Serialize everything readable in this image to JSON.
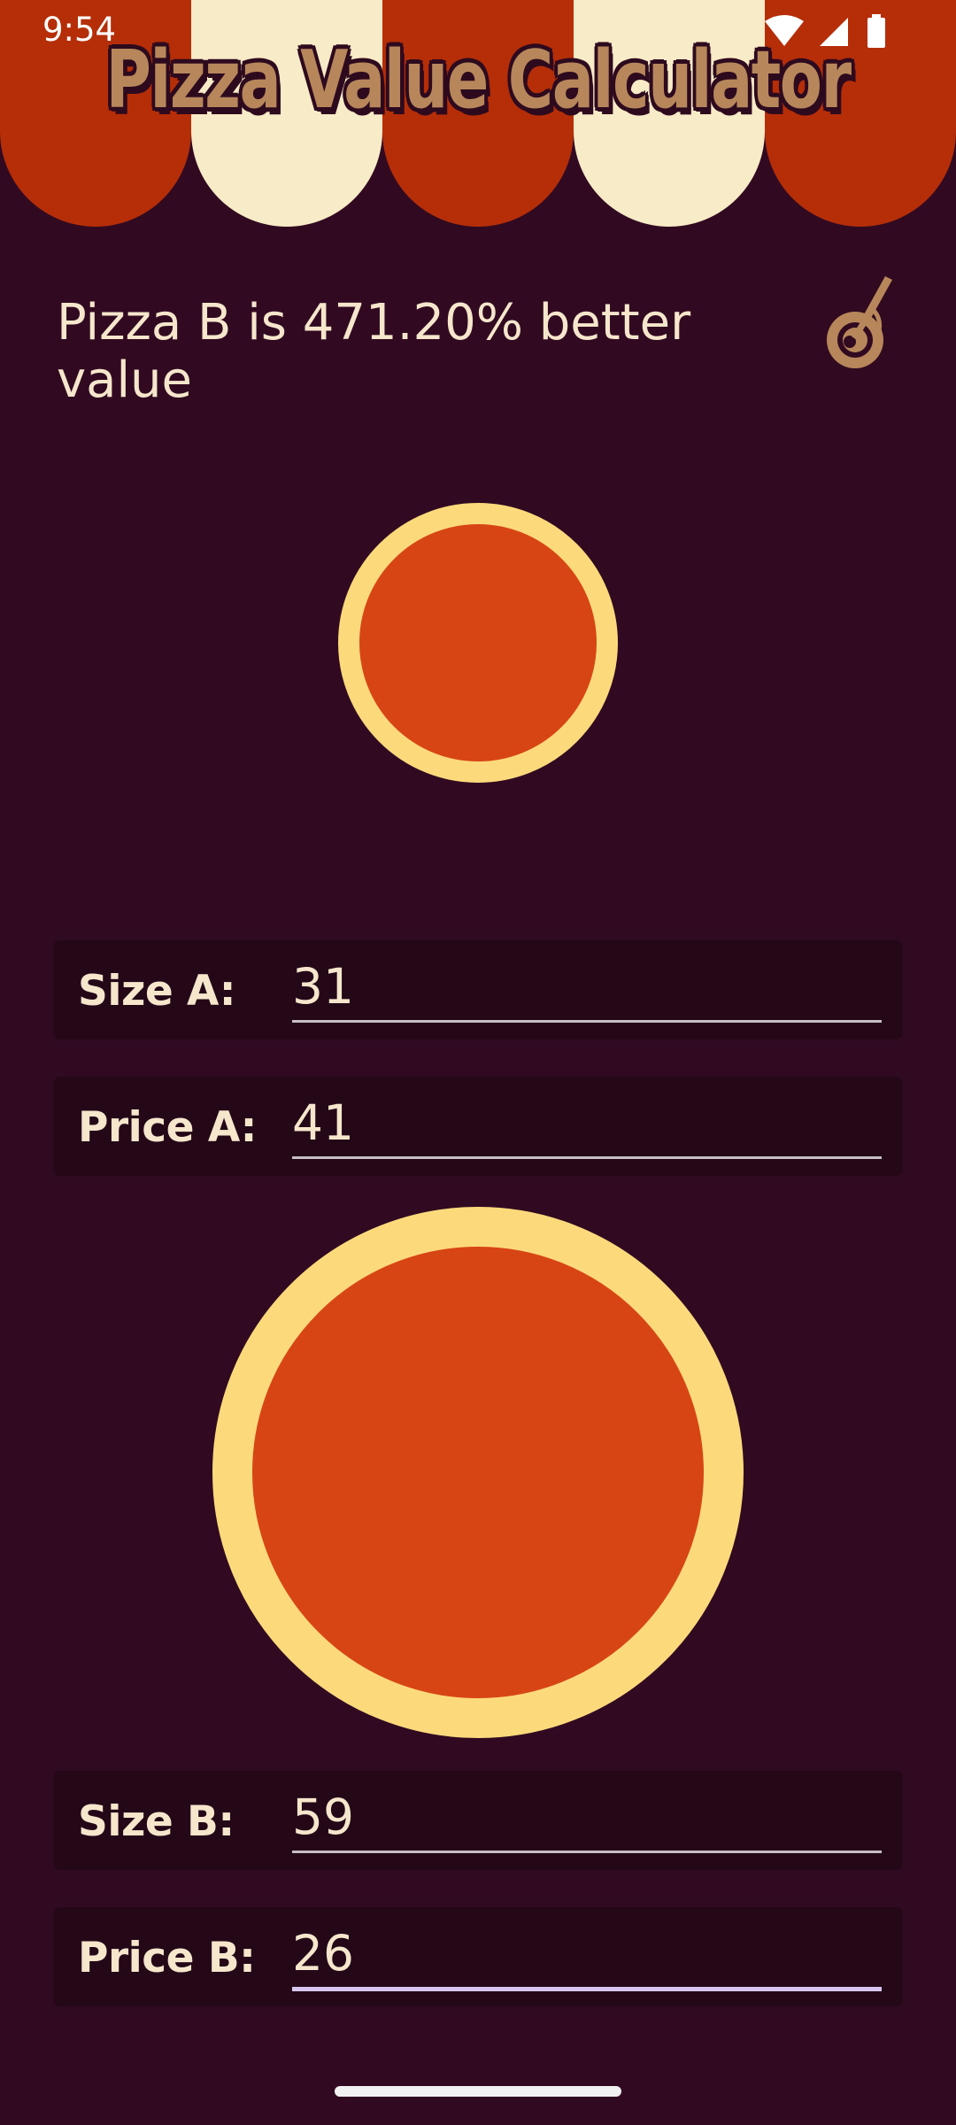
{
  "status_bar": {
    "time": "9:54",
    "icons": [
      "wifi-icon",
      "cellular-signal-icon",
      "battery-icon"
    ]
  },
  "header": {
    "title": "Pizza Value Calculator"
  },
  "result": {
    "text": "Pizza B is 471.20% better value",
    "icon": "pizza-cutter-icon"
  },
  "pizza_a": {
    "size": {
      "label": "Size A:",
      "value": "31"
    },
    "price": {
      "label": "Price A:",
      "value": "41"
    }
  },
  "pizza_b": {
    "size": {
      "label": "Size B:",
      "value": "59"
    },
    "price": {
      "label": "Price B:",
      "value": "26"
    }
  },
  "colors": {
    "background": "#310a21",
    "awning_red": "#b52e08",
    "awning_cream": "#f8ebc7",
    "pizza_crust": "#fcda7c",
    "pizza_sauce": "#d84515",
    "title_color": "#b7875b",
    "text": "#f6e6cc"
  }
}
